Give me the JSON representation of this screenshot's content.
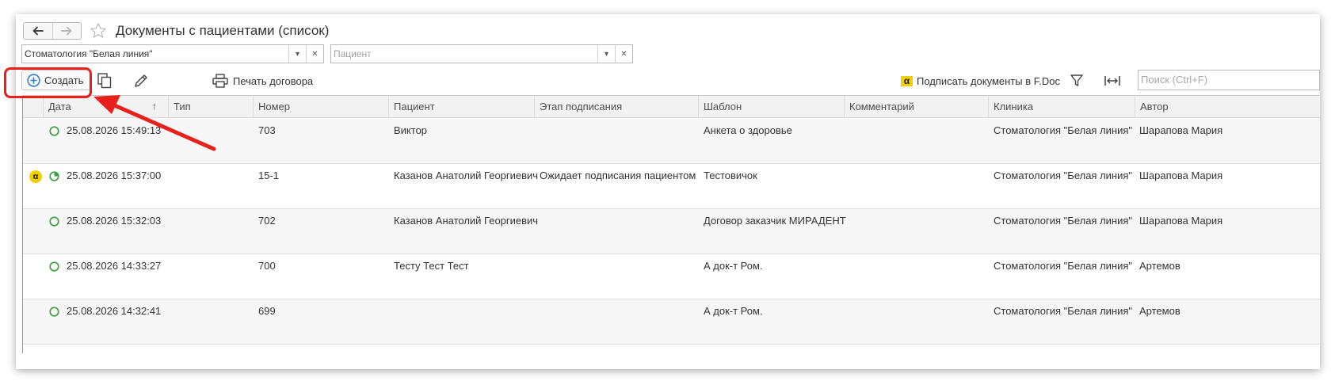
{
  "window": {
    "title": "Документы с пациентами (список)"
  },
  "filters": {
    "clinic": {
      "value": "Стоматология \"Белая линия\""
    },
    "patient": {
      "placeholder": "Пациент"
    }
  },
  "toolbar": {
    "create_label": "Создать",
    "print_label": "Печать договора",
    "sign_label": "Подписать документы в F.Doc",
    "fdoc_logo": "α",
    "search_placeholder": "Поиск (Ctrl+F)"
  },
  "table": {
    "columns": [
      "Дата",
      "Тип",
      "Номер",
      "Пациент",
      "Этап подписания",
      "Шаблон",
      "Комментарий",
      "Клиника",
      "Автор"
    ],
    "sort_indicator": "↑",
    "rows": [
      {
        "date": "25.08.2026 15:49:13",
        "type": "",
        "number": "703",
        "patient": "Виктор",
        "stage": "",
        "template": "Анкета о здоровье",
        "comment": "",
        "clinic": "Стоматология \"Белая линия\"",
        "author": "Шарапова Мария",
        "fdoc": "",
        "status": "open"
      },
      {
        "date": "25.08.2026 15:37:00",
        "type": "",
        "number": "15-1",
        "patient": "Казанов Анатолий Георгиевич",
        "stage": "Ожидает подписания пациентом",
        "template": "Тестовичок",
        "comment": "",
        "clinic": "Стоматология \"Белая линия\"",
        "author": "Шарапова Мария",
        "fdoc": "α",
        "status": "pending"
      },
      {
        "date": "25.08.2026 15:32:03",
        "type": "",
        "number": "702",
        "patient": "Казанов Анатолий Георгиевич",
        "stage": "",
        "template": "Договор заказчик МИРАДЕНТ",
        "comment": "",
        "clinic": "Стоматология \"Белая линия\"",
        "author": "Шарапова Мария",
        "fdoc": "",
        "status": "open"
      },
      {
        "date": "25.08.2026 14:33:27",
        "type": "",
        "number": "700",
        "patient": "Тесту Тест Тест",
        "stage": "",
        "template": "А док-т Ром.",
        "comment": "",
        "clinic": "Стоматология \"Белая линия\"",
        "author": "Артемов",
        "fdoc": "",
        "status": "open"
      },
      {
        "date": "25.08.2026 14:32:41",
        "type": "",
        "number": "699",
        "patient": "",
        "stage": "",
        "template": "А док-т Ром.",
        "comment": "",
        "clinic": "Стоматология \"Белая линия\"",
        "author": "Артемов",
        "fdoc": "",
        "status": "open"
      }
    ]
  },
  "colors": {
    "accent": "#2d7fd3",
    "status_green": "#3fa13f",
    "highlight_red": "#e8201c",
    "fdoc_yellow": "#f2d000"
  }
}
